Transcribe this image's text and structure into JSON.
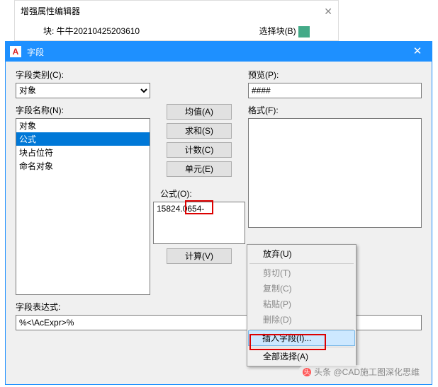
{
  "backwin": {
    "title": "增强属性编辑器",
    "block_label": "块: 牛牛20210425203610",
    "select_label": "选择块(B)"
  },
  "mainwin": {
    "logo": "A",
    "title": "字段",
    "field_category_label": "字段类别(C):",
    "field_category_value": "对象",
    "field_name_label": "字段名称(N):",
    "field_names": [
      "对象",
      "公式",
      "块占位符",
      "命名对象"
    ],
    "selected_field_index": 1,
    "buttons": {
      "avg": "均值(A)",
      "sum": "求和(S)",
      "count": "计数(C)",
      "cell": "单元(E)",
      "calc": "计算(V)"
    },
    "preview_label": "预览(P):",
    "preview_value": "####",
    "format_label": "格式(F):",
    "formula_label": "公式(O):",
    "formula_value": "15824.0654-",
    "expr_label": "字段表达式:",
    "expr_value": "%<\\AcExpr>%"
  },
  "ctxmenu": {
    "undo": "放弃(U)",
    "cut": "剪切(T)",
    "copy": "复制(C)",
    "paste": "粘贴(P)",
    "delete": "删除(D)",
    "insert_field": "插入字段(I)...",
    "select_all": "全部选择(A)"
  },
  "watermark": "头条 @CAD施工图深化思维"
}
